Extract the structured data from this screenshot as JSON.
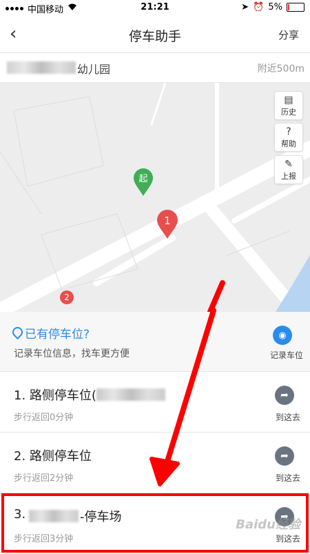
{
  "status": {
    "carrier": "中国移动",
    "time": "21:21",
    "battery": "5%"
  },
  "nav": {
    "back_symbol": "‹",
    "title": "停车助手",
    "share": "分享"
  },
  "destination": {
    "name": "幼儿园",
    "distance": "附近500m"
  },
  "map": {
    "tools": [
      {
        "icon": "history-icon",
        "glyph": "▤",
        "label": "历史"
      },
      {
        "icon": "help-icon",
        "glyph": "?",
        "label": "帮助"
      },
      {
        "icon": "report-icon",
        "glyph": "✎",
        "label": "上报"
      }
    ],
    "start_label": "起",
    "markers": [
      "1",
      "2"
    ]
  },
  "tip": {
    "title": "已有停车位?",
    "subtitle": "记录车位信息，找车更方便",
    "record_label": "记录车位"
  },
  "list": [
    {
      "title": "1. 路侧停车位(",
      "sub": "步行返回0分钟",
      "go": "到这去"
    },
    {
      "title": "2. 路侧停车位",
      "sub": "步行返回2分钟",
      "go": "到这去"
    },
    {
      "title_prefix": "3. ",
      "title_suffix": "-停车场",
      "sub": "步行返回3分钟",
      "go": "到这去"
    }
  ],
  "watermark": "Baidu经验",
  "colors": {
    "accent": "#2a8ceb",
    "marker_red": "#e84e4e",
    "start_green": "#3fae55",
    "annotation_red": "#ff0000"
  }
}
